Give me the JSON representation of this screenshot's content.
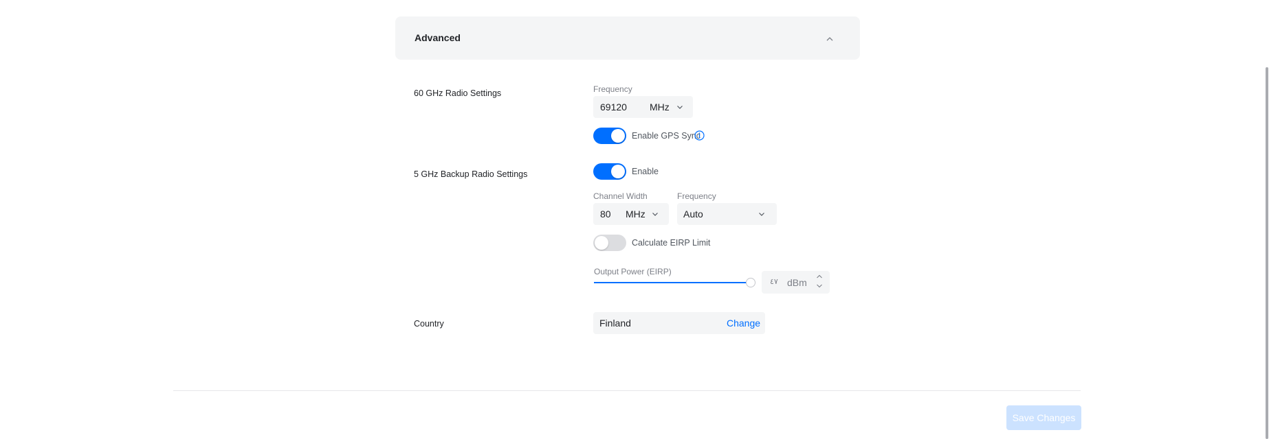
{
  "advanced": {
    "title": "Advanced"
  },
  "radio60": {
    "label": "60 GHz Radio Settings",
    "frequency_label": "Frequency",
    "frequency_value": "69120",
    "frequency_unit": "MHz",
    "gps_sync_label": "Enable GPS Sync",
    "gps_sync_enabled": true
  },
  "radio5": {
    "label": "5 GHz Backup Radio Settings",
    "enable_label": "Enable",
    "enabled": true,
    "channel_width_label": "Channel Width",
    "channel_width_value": "80",
    "channel_width_unit": "MHz",
    "frequency_label": "Frequency",
    "frequency_value": "Auto",
    "eirp_limit_label": "Calculate EIRP Limit",
    "eirp_limit_enabled": false,
    "output_power_label": "Output Power (EIRP)",
    "output_power_value": "٤٧",
    "output_power_unit": "dBm"
  },
  "country": {
    "label": "Country",
    "value": "Finland",
    "change_label": "Change"
  },
  "footer": {
    "save_label": "Save Changes"
  },
  "colors": {
    "accent": "#006fff",
    "panel": "#f4f5f6",
    "save_disabled": "#cce2ff"
  }
}
